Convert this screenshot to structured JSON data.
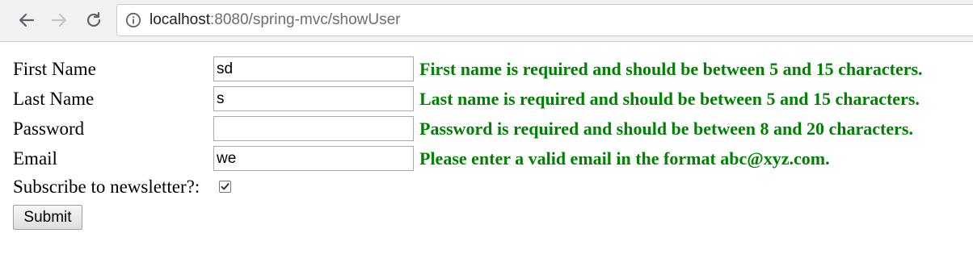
{
  "browser": {
    "url_host": "localhost",
    "url_rest": ":8080/spring-mvc/showUser"
  },
  "form": {
    "first_name": {
      "label": "First Name",
      "value": "sd",
      "error": "First name is required and should be between 5 and 15 characters."
    },
    "last_name": {
      "label": "Last Name",
      "value": "s",
      "error": "Last name is required and should be between 5 and 15 characters."
    },
    "password": {
      "label": "Password",
      "value": "",
      "error": "Password is required and should be between 8 and 20 characters."
    },
    "email": {
      "label": "Email",
      "value": "we",
      "error": "Please enter a valid email in the format abc@xyz.com."
    },
    "subscribe": {
      "label": "Subscribe to newsletter?:",
      "checked": true
    },
    "submit_label": "Submit"
  },
  "colors": {
    "error": "#008000"
  }
}
